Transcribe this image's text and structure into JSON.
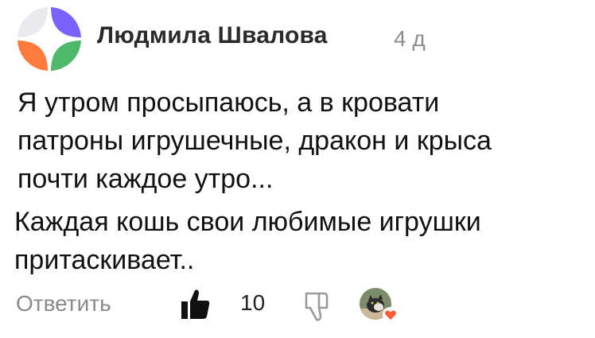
{
  "comment": {
    "author": "Людмила Швалова",
    "time": "4 д",
    "lines": [
      "Я утром просыпаюсь, а в кровати",
      "патроны игрушечные, дракон и крыса",
      "почти  каждое утро...",
      "Каждая кошь свои любимые игрушки",
      "притаскивает.."
    ]
  },
  "actions": {
    "reply_label": "Ответить",
    "like_count": "10"
  },
  "icons": {
    "avatar": "author-avatar-icon",
    "like": "thumbs-up-icon",
    "dislike": "thumbs-down-icon",
    "reaction": "heart-icon"
  },
  "colors": {
    "avatar_tl": "#e9e9ee",
    "avatar_tr": "#7b61ff",
    "avatar_bl": "#ff7a3c",
    "avatar_br": "#4fb86b",
    "heart": "#ff5a36"
  }
}
